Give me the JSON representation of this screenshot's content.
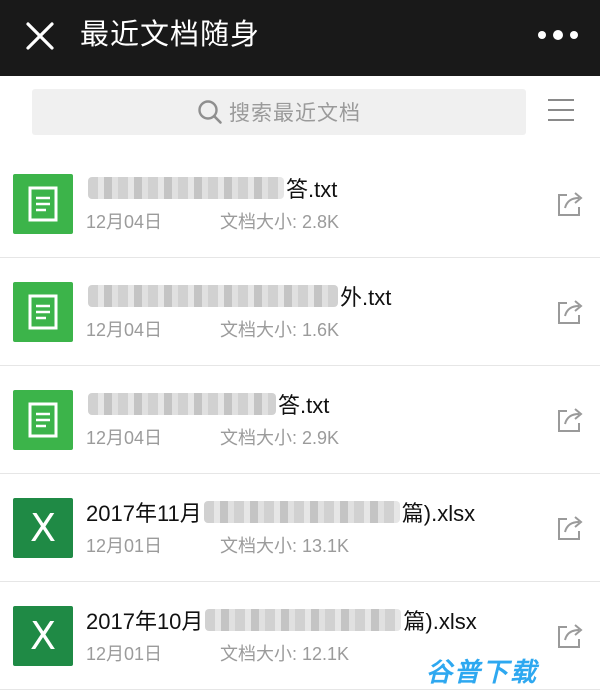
{
  "header": {
    "title": "最近文档随身",
    "close_icon": "close-icon",
    "more_icon": "more-dots-icon"
  },
  "search": {
    "placeholder": "搜索最近文档",
    "icon": "search-icon",
    "menu_icon": "menu-icon"
  },
  "files": [
    {
      "type": "txt",
      "name_prefix_blur": true,
      "name_suffix": "答.txt",
      "date": "12月04日",
      "size": "文档大小: 2.8K"
    },
    {
      "type": "txt",
      "name_prefix_blur": true,
      "name_suffix": "外.txt",
      "date": "12月04日",
      "size": "文档大小: 1.6K"
    },
    {
      "type": "txt",
      "name_prefix_blur": true,
      "name_suffix": "答.txt",
      "date": "12月04日",
      "size": "文档大小: 2.9K"
    },
    {
      "type": "xlsx",
      "name_prefix": "2017年11月",
      "name_suffix": "篇).xlsx",
      "date": "12月01日",
      "size": "文档大小: 13.1K",
      "icon_letter": "X"
    },
    {
      "type": "xlsx",
      "name_prefix": "2017年10月",
      "name_suffix": "篇).xlsx",
      "date": "12月01日",
      "size": "文档大小: 12.1K",
      "icon_letter": "X"
    }
  ],
  "watermark": "谷普下载",
  "colors": {
    "topbar": "#191919",
    "txt_icon": "#3cb44a",
    "xls_icon": "#1f8a45",
    "meta_text": "#9b9b9b",
    "watermark": "#2ea8f0"
  }
}
